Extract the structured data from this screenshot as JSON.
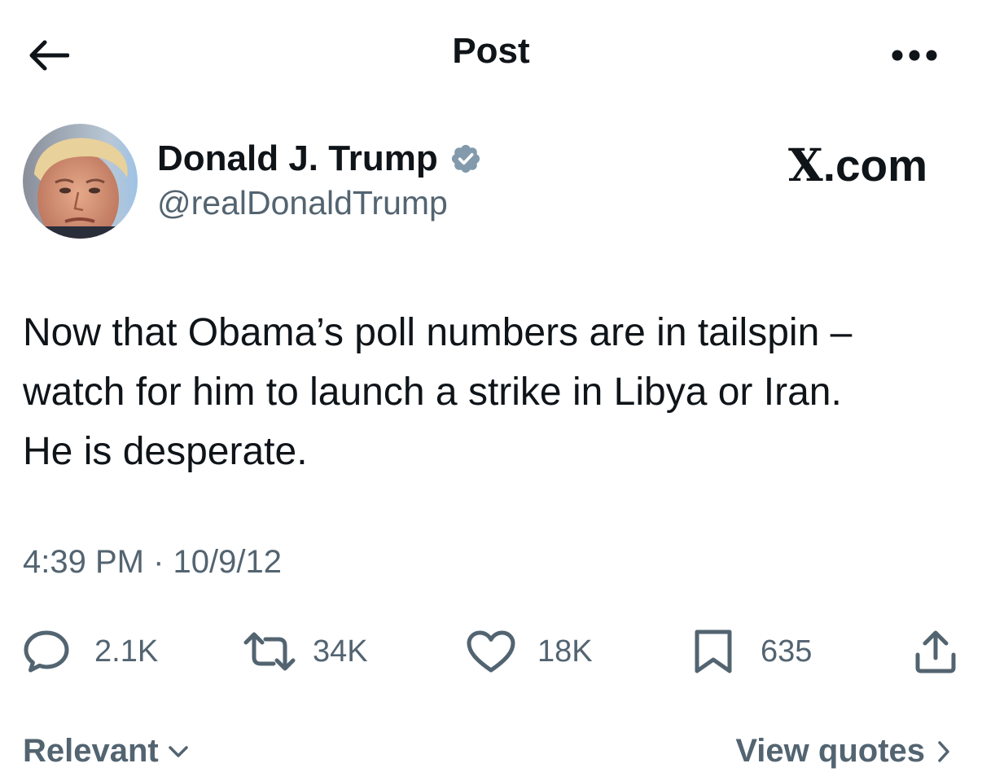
{
  "header": {
    "title": "Post"
  },
  "author": {
    "name": "Donald J. Trump",
    "handle": "@realDonaldTrump",
    "verified": true
  },
  "watermark": {
    "x_letter": "X",
    "suffix": ".com"
  },
  "post": {
    "text": "Now that Obama’s poll numbers are in tailspin –\nwatch for him to launch a strike in Libya or Iran.\nHe is desperate.",
    "timestamp": "4:39 PM · 10/9/12"
  },
  "actions": {
    "replies": "2.1K",
    "reposts": "34K",
    "likes": "18K",
    "bookmarks": "635"
  },
  "footer": {
    "sort_label": "Relevant",
    "view_quotes_label": "View quotes"
  },
  "icons": {
    "back": "arrow-left-icon",
    "more": "more-horizontal-icon",
    "verified": "verified-badge-icon",
    "reply": "reply-icon",
    "repost": "repost-icon",
    "like": "heart-icon",
    "bookmark": "bookmark-icon",
    "share": "share-icon"
  },
  "colors": {
    "text_primary": "#0f1419",
    "text_secondary": "#536471",
    "verified_badge": "#829aab"
  }
}
